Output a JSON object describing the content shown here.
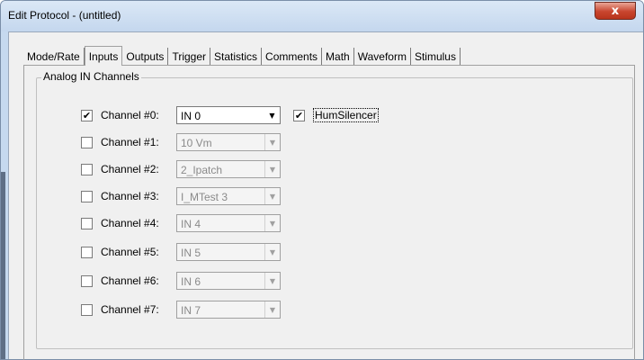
{
  "window": {
    "title": "Edit Protocol - (untitled)",
    "close_glyph": "x"
  },
  "tabs": [
    "Mode/Rate",
    "Inputs",
    "Outputs",
    "Trigger",
    "Statistics",
    "Comments",
    "Math",
    "Waveform",
    "Stimulus"
  ],
  "active_tab": "Inputs",
  "group": {
    "label": "Analog IN Channels"
  },
  "channels": [
    {
      "label": "Channel #0:",
      "checked": true,
      "value": "IN 0"
    },
    {
      "label": "Channel #1:",
      "checked": false,
      "value": "10 Vm"
    },
    {
      "label": "Channel #2:",
      "checked": false,
      "value": "2_Ipatch"
    },
    {
      "label": "Channel #3:",
      "checked": false,
      "value": "I_MTest 3"
    },
    {
      "label": "Channel #4:",
      "checked": false,
      "value": "IN 4"
    },
    {
      "label": "Channel #5:",
      "checked": false,
      "value": "IN 5"
    },
    {
      "label": "Channel #6:",
      "checked": false,
      "value": "IN 6"
    },
    {
      "label": "Channel #7:",
      "checked": false,
      "value": "IN 7"
    }
  ],
  "hum_silencer": {
    "label": "HumSilencer",
    "checked": true
  },
  "icons": {
    "close": "close-icon",
    "dropdown": "chevron-down-icon",
    "check": "checkmark-icon"
  },
  "colors": {
    "titlebar": "#c6d9ef",
    "close_button": "#c8452e",
    "dialog_bg": "#f0f0f0"
  }
}
